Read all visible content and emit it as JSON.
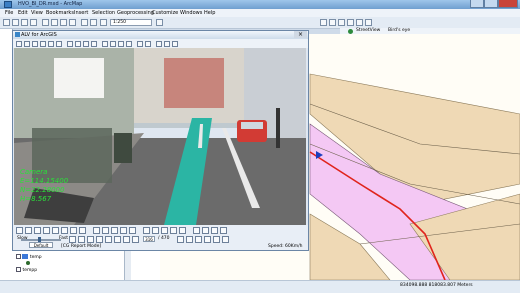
{
  "app_window": {
    "title": "HVO_BI_DR.mxd - ArcMap",
    "menus": [
      "File",
      "Edit",
      "View",
      "Bookmarks",
      "Insert",
      "Selection",
      "Geoprocessing",
      "Customize",
      "Windows",
      "Help"
    ],
    "scale": "1:250"
  },
  "street_view_tabs": {
    "street": "StreetView",
    "birds": "Bird's eye"
  },
  "toc": {
    "layers": [
      {
        "label": "temp"
      },
      {
        "label": "temp"
      },
      {
        "label": "tempp"
      }
    ]
  },
  "alv_window": {
    "title": "ALV for ArcGIS",
    "readout": {
      "label": "Camera",
      "e": "E=114.15400",
      "n": "N=22.28000",
      "h": "H=8.567"
    },
    "slow_label": "Slow",
    "default_label": "Default",
    "fast_label": "Fast",
    "mode_label": "[CG Report Mode]",
    "frame_current": "316",
    "frame_total": "/ 470",
    "speed_label": "Speed: 60Km/h"
  },
  "status": {
    "coords": "834098.888  818083.807 Meters"
  },
  "colors": {
    "route": "#e0241c",
    "zone_pink": "#f4c8f4",
    "zone_tan": "#efd9b5",
    "teal_lane": "#2bb5a4"
  }
}
